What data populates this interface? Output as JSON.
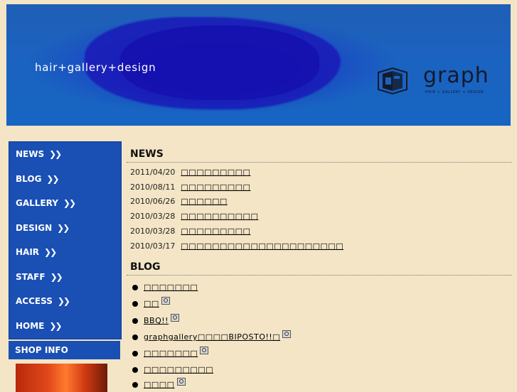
{
  "header": {
    "tagline": "hair+gallery+design",
    "logo_word": "graph",
    "logo_sub": "HAIR + GALLERY + DESIGN"
  },
  "nav": [
    {
      "label": "NEWS",
      "arrow": "❯❯"
    },
    {
      "label": "BLOG",
      "arrow": "❯❯"
    },
    {
      "label": "GALLERY",
      "arrow": "❯❯"
    },
    {
      "label": "DESIGN",
      "arrow": "❯❯"
    },
    {
      "label": "HAIR",
      "arrow": "❯❯"
    },
    {
      "label": "STAFF",
      "arrow": "❯❯"
    },
    {
      "label": "ACCESS",
      "arrow": "❯❯"
    },
    {
      "label": "HOME",
      "arrow": "❯❯"
    }
  ],
  "shop_info": {
    "label": "SHOP INFO"
  },
  "news": {
    "heading": "NEWS",
    "items": [
      {
        "date": "2011/04/20",
        "title": "□□□□□□□□□"
      },
      {
        "date": "2010/08/11",
        "title": "□□□□□□□□□"
      },
      {
        "date": "2010/06/26",
        "title": "□□□□□□"
      },
      {
        "date": "2010/03/28",
        "title": "□□□□□□□□□□"
      },
      {
        "date": "2010/03/28",
        "title": "□□□□□□□□□"
      },
      {
        "date": "2010/03/17",
        "title": "□□□□□□□□□□□□□□□□□□□□□"
      }
    ]
  },
  "blog": {
    "heading": "BLOG",
    "items": [
      {
        "title": "□□□□□□□",
        "camera": false
      },
      {
        "title": "□□",
        "camera": true
      },
      {
        "title": "BBQ!!",
        "camera": true
      },
      {
        "title": "graphgallery□□□□BIPOSTO!!□",
        "camera": true
      },
      {
        "title": "□□□□□□□",
        "camera": true
      },
      {
        "title": "□□□□□□□□□",
        "camera": false
      },
      {
        "title": "□□□□",
        "camera": true
      }
    ]
  },
  "colors": {
    "background": "#f3e5c6",
    "nav_blue": "#1a4fb4",
    "banner_blue": "#1b63c0"
  }
}
